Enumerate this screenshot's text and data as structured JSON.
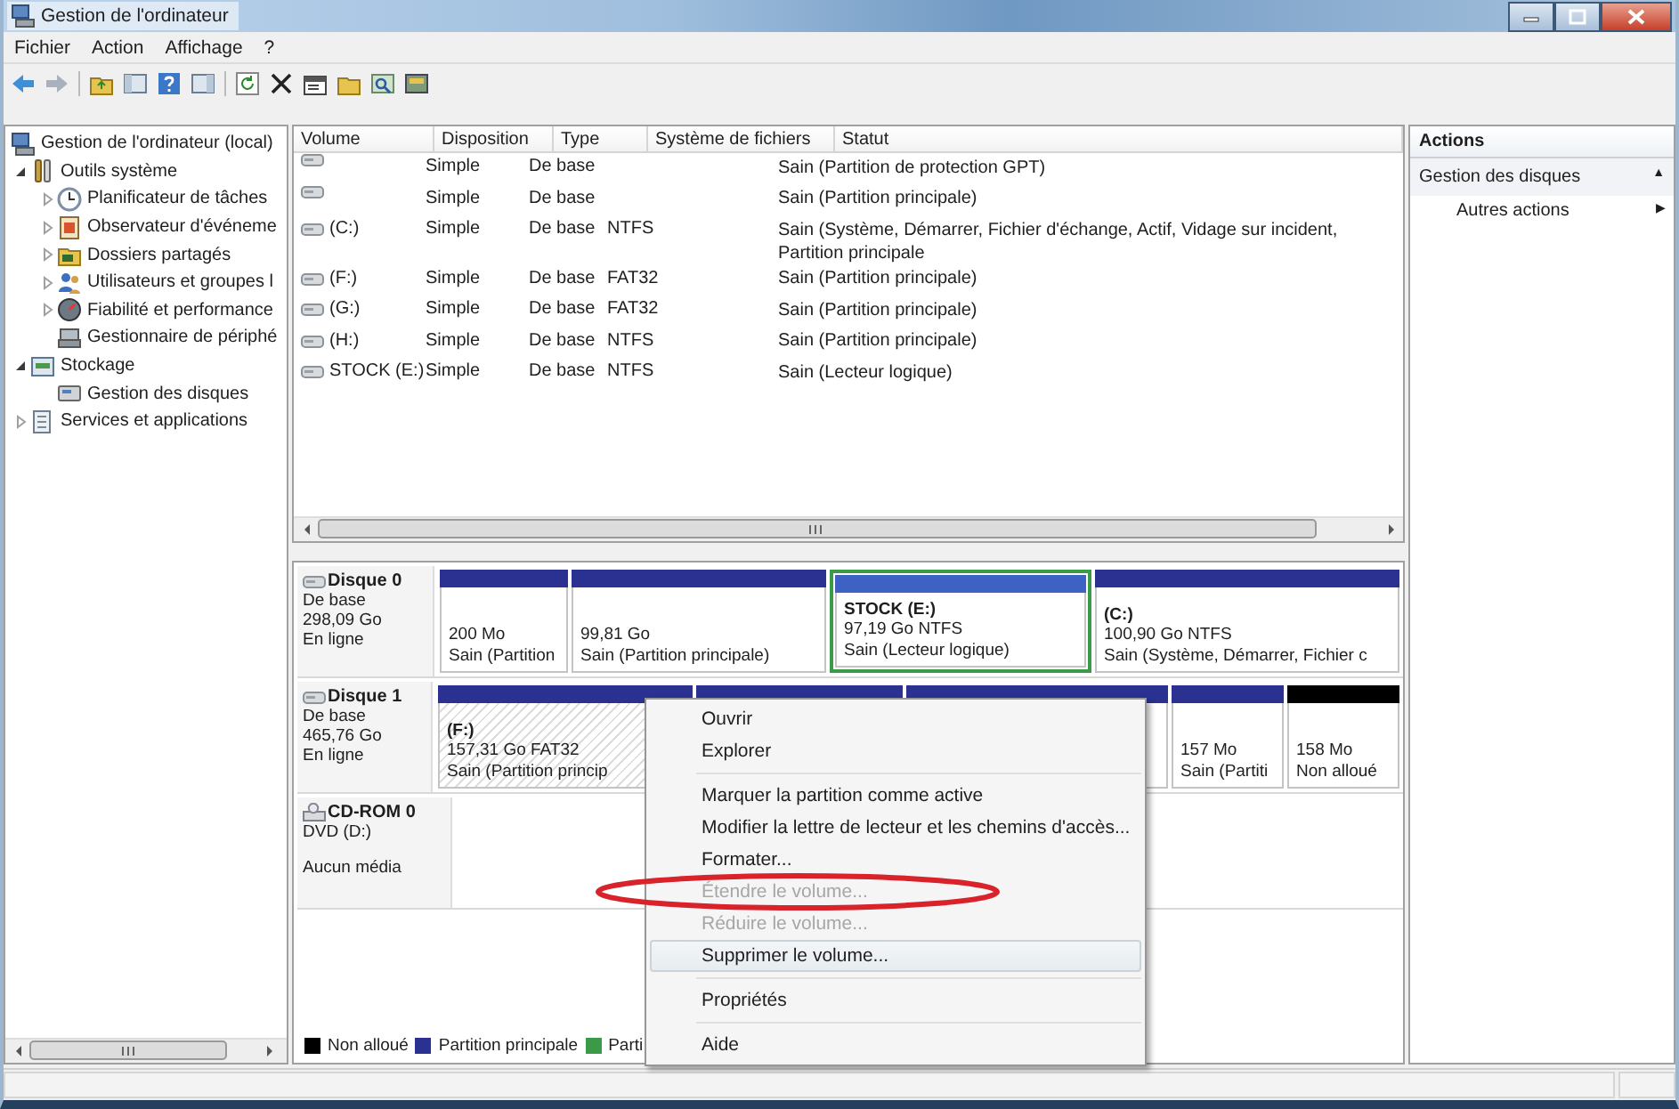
{
  "window": {
    "title": "Gestion de l'ordinateur"
  },
  "menu_bar": [
    "Fichier",
    "Action",
    "Affichage",
    "?"
  ],
  "tree": [
    {
      "label": "Gestion de l'ordinateur (local)",
      "children": [
        {
          "label": "Outils système",
          "expanded": true,
          "children": [
            {
              "label": "Planificateur de tâches",
              "expanded": false
            },
            {
              "label": "Observateur d'événeme",
              "expanded": false
            },
            {
              "label": "Dossiers partagés",
              "expanded": false
            },
            {
              "label": "Utilisateurs et groupes l",
              "expanded": false
            },
            {
              "label": "Fiabilité et performance",
              "expanded": false
            },
            {
              "label": "Gestionnaire de périphé"
            }
          ]
        },
        {
          "label": "Stockage",
          "expanded": true,
          "children": [
            {
              "label": "Gestion des disques"
            }
          ]
        },
        {
          "label": "Services et applications",
          "expanded": false
        }
      ]
    }
  ],
  "volume_table": {
    "columns": [
      "Volume",
      "Disposition",
      "Type",
      "Système de fichiers",
      "Statut"
    ],
    "rows": [
      {
        "layout": "Simple",
        "type": "De base",
        "status": "Sain (Partition de protection GPT)"
      },
      {
        "layout": "Simple",
        "type": "De base",
        "status": "Sain (Partition principale)"
      },
      {
        "volume": "(C:)",
        "layout": "Simple",
        "type": "De base",
        "file_system": "NTFS",
        "status": "Sain (Système, Démarrer, Fichier d'échange, Actif, Vidage sur incident, Partition principale"
      },
      {
        "volume": "(F:)",
        "layout": "Simple",
        "type": "De base",
        "file_system": "FAT32",
        "status": "Sain (Partition principale)"
      },
      {
        "volume": "(G:)",
        "layout": "Simple",
        "type": "De base",
        "file_system": "FAT32",
        "status": "Sain (Partition principale)"
      },
      {
        "volume": "(H:)",
        "layout": "Simple",
        "type": "De base",
        "file_system": "NTFS",
        "status": "Sain (Partition principale)"
      },
      {
        "volume": "STOCK (E:)",
        "layout": "Simple",
        "type": "De base",
        "file_system": "NTFS",
        "status": "Sain (Lecteur logique)"
      }
    ]
  },
  "disks": [
    {
      "kind": "disk",
      "name": "Disque 0",
      "type": "De base",
      "size": "298,09 Go",
      "status": "En ligne",
      "partitions": [
        {
          "kind": "primary",
          "selected": false,
          "size": "200 Mo",
          "status": "Sain (Partition"
        },
        {
          "kind": "primary",
          "selected": false,
          "size": "99,81 Go",
          "status": "Sain (Partition principale)"
        },
        {
          "kind": "logical",
          "selected": false,
          "name": "STOCK  (E:)",
          "size": "97,19 Go NTFS",
          "status": "Sain (Lecteur logique)"
        },
        {
          "kind": "primary",
          "selected": false,
          "name": "(C:)",
          "size": "100,90 Go NTFS",
          "status": "Sain (Système, Démarrer, Fichier c"
        }
      ]
    },
    {
      "kind": "disk",
      "name": "Disque 1",
      "type": "De base",
      "size": "465,76 Go",
      "status": "En ligne",
      "partitions": [
        {
          "kind": "primary",
          "selected": true,
          "name": "(F:)",
          "size": "157,31 Go FAT32",
          "status": "Sain (Partition princip"
        },
        {
          "kind": "primary"
        },
        {
          "kind": "primary"
        },
        {
          "kind": "primary",
          "selected": false,
          "size": "157 Mo",
          "status": "Sain (Partiti"
        },
        {
          "kind": "unallocated",
          "selected": false,
          "size": "158 Mo",
          "status": "Non alloué"
        }
      ]
    },
    {
      "kind": "cdrom",
      "name": "CD-ROM 0",
      "type": "DVD (D:)",
      "status": "Aucun média"
    }
  ],
  "legend": [
    {
      "label": "Non alloué",
      "color": "#000000"
    },
    {
      "label": "Partition principale",
      "color": "#2a3190"
    },
    {
      "label": "Parti",
      "color": "#3b9a48"
    }
  ],
  "actions": {
    "title": "Actions",
    "sections": [
      {
        "label": "Gestion des disques",
        "glyph": "▲",
        "items": [
          {
            "label": "Autres actions",
            "glyph": "▶"
          }
        ]
      }
    ]
  },
  "context_menu": [
    {
      "kind": "item",
      "label": "Ouvrir",
      "disabled": false,
      "selected": false,
      "circled": false
    },
    {
      "kind": "item",
      "label": "Explorer",
      "disabled": false,
      "selected": false,
      "circled": false
    },
    {
      "kind": "separator"
    },
    {
      "kind": "item",
      "label": "Marquer la partition comme active",
      "disabled": false,
      "selected": false,
      "circled": false
    },
    {
      "kind": "item",
      "label": "Modifier la lettre de lecteur et les chemins d'accès...",
      "disabled": false,
      "selected": false,
      "circled": false
    },
    {
      "kind": "item",
      "label": "Formater...",
      "disabled": false,
      "selected": false,
      "circled": false
    },
    {
      "kind": "item",
      "label": "Étendre le volume...",
      "disabled": true,
      "selected": false,
      "circled": true
    },
    {
      "kind": "item",
      "label": "Réduire le volume...",
      "disabled": true,
      "selected": false,
      "circled": false
    },
    {
      "kind": "item",
      "label": "Supprimer le volume...",
      "disabled": false,
      "selected": true,
      "circled": false
    },
    {
      "kind": "separator"
    },
    {
      "kind": "item",
      "label": "Propriétés",
      "disabled": false,
      "selected": false,
      "circled": false
    },
    {
      "kind": "separator"
    },
    {
      "kind": "item",
      "label": "Aide",
      "disabled": false,
      "selected": false,
      "circled": false
    }
  ]
}
